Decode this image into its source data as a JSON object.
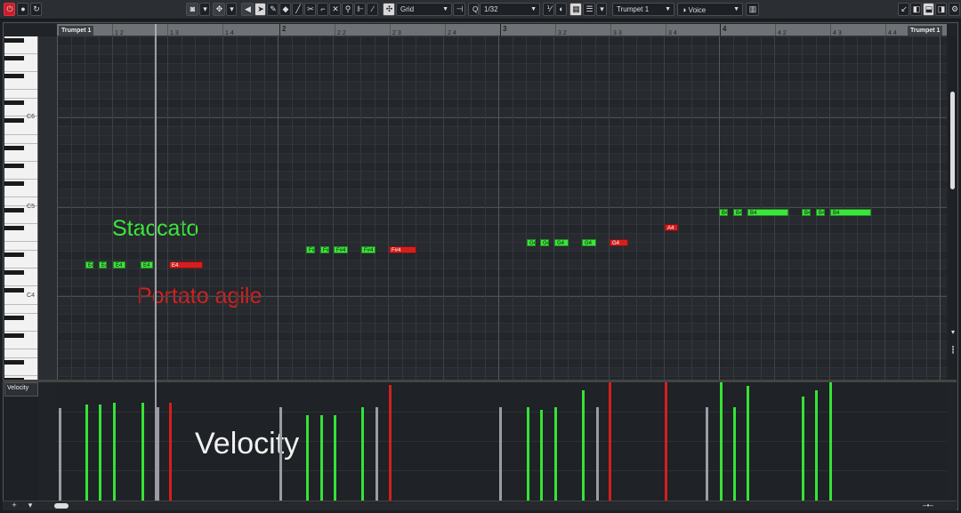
{
  "toolbar": {
    "snap_mode": "Grid",
    "quantize_value": "1/32",
    "track_selector": "Trumpet 1",
    "expression_selector": "Voice",
    "quantize_icon": "Q",
    "record_icon": "record-icon"
  },
  "ruler": {
    "bars": [
      "2",
      "3",
      "4"
    ],
    "sub_ticks": [
      "1 2",
      "1 3",
      "1 4",
      "2 2",
      "2 3",
      "2 4",
      "3 2",
      "3 3",
      "3 4",
      "4 2",
      "4 3",
      "4 4"
    ]
  },
  "track": {
    "name_left": "Trumpet 1",
    "name_right": "Trumpet 1"
  },
  "keyboard": {
    "octave_labels": [
      "C6",
      "C5",
      "C4"
    ]
  },
  "notes": [
    {
      "label": "E4",
      "color": "g"
    },
    {
      "label": "E4",
      "color": "g"
    },
    {
      "label": "E4",
      "color": "g"
    },
    {
      "label": "E4",
      "color": "g"
    },
    {
      "label": "E4",
      "color": "r"
    },
    {
      "label": "F#4",
      "color": "g"
    },
    {
      "label": "F#4",
      "color": "g"
    },
    {
      "label": "F#4",
      "color": "g"
    },
    {
      "label": "F#4",
      "color": "g"
    },
    {
      "label": "F#4",
      "color": "r"
    },
    {
      "label": "G4",
      "color": "g"
    },
    {
      "label": "G4",
      "color": "g"
    },
    {
      "label": "G4",
      "color": "g"
    },
    {
      "label": "G4",
      "color": "g"
    },
    {
      "label": "G4",
      "color": "r"
    },
    {
      "label": "A4",
      "color": "r"
    },
    {
      "label": "B4",
      "color": "g"
    },
    {
      "label": "B4",
      "color": "g"
    },
    {
      "label": "B4",
      "color": "g"
    },
    {
      "label": "B4",
      "color": "g"
    },
    {
      "label": "B4",
      "color": "g"
    },
    {
      "label": "B4",
      "color": "g"
    }
  ],
  "annotations": {
    "staccato": "Staccato",
    "portato": "Portato agile",
    "velocity": "Velocity",
    "staccato_color": "#3be63b",
    "portato_color": "#d51f1f"
  },
  "controller_lane": {
    "label": "Velocity"
  },
  "velocity_bars": [
    {
      "color": "w",
      "level": 0.78
    },
    {
      "color": "g",
      "level": 0.81
    },
    {
      "color": "g",
      "level": 0.81
    },
    {
      "color": "g",
      "level": 0.83
    },
    {
      "color": "g",
      "level": 0.83
    },
    {
      "color": "w",
      "level": 0.79
    },
    {
      "color": "r",
      "level": 0.83
    },
    {
      "color": "w",
      "level": 0.79
    },
    {
      "color": "g",
      "level": 0.72
    },
    {
      "color": "g",
      "level": 0.72
    },
    {
      "color": "g",
      "level": 0.72
    },
    {
      "color": "g",
      "level": 0.79
    },
    {
      "color": "w",
      "level": 0.79
    },
    {
      "color": "r",
      "level": 0.98
    },
    {
      "color": "w",
      "level": 0.79
    },
    {
      "color": "g",
      "level": 0.79
    },
    {
      "color": "g",
      "level": 0.77
    },
    {
      "color": "g",
      "level": 0.79
    },
    {
      "color": "g",
      "level": 0.93
    },
    {
      "color": "w",
      "level": 0.79
    },
    {
      "color": "r",
      "level": 1.0
    },
    {
      "color": "r",
      "level": 1.0
    },
    {
      "color": "w",
      "level": 0.79
    },
    {
      "color": "g",
      "level": 1.0
    },
    {
      "color": "g",
      "level": 0.79
    },
    {
      "color": "g",
      "level": 0.97
    },
    {
      "color": "g",
      "level": 0.88
    },
    {
      "color": "g",
      "level": 0.93
    },
    {
      "color": "g",
      "level": 1.0
    }
  ],
  "colors": {
    "staccato_green": "#3be63b",
    "portato_red": "#d51f1f",
    "accent_red": "#c81e2b"
  }
}
